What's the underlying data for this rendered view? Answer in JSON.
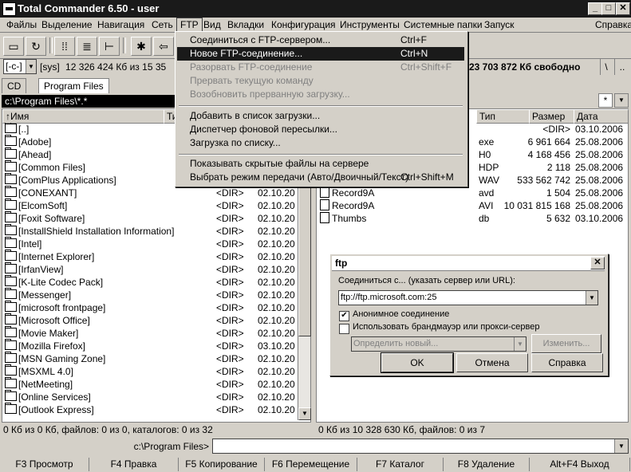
{
  "window": {
    "title": "Total Commander 6.50 - user"
  },
  "menubar": {
    "items": [
      "Файлы",
      "Выделение",
      "Навигация",
      "Сеть",
      "FTP",
      "Вид",
      "Вкладки",
      "Конфигурация",
      "Инструменты",
      "Системные папки",
      "Запуск"
    ],
    "help": "Справка"
  },
  "drivebar": {
    "left_drive": "[-c-]",
    "left_label": "[sys]",
    "left_free": "12 326 424 Кб из 15 35",
    "right_free": "23 703 872 Кб свободно",
    "root": "\\",
    "up": ".."
  },
  "tabs": {
    "cd": "CD",
    "program_files": "Program Files"
  },
  "left_panel": {
    "path": "c:\\Program Files\\*.*",
    "headers": {
      "name": "↑Имя",
      "type": "Ти"
    },
    "rows": [
      {
        "name": "[..]",
        "size": "",
        "date": ""
      },
      {
        "name": "[Adobe]",
        "size": "",
        "date": ""
      },
      {
        "name": "[Ahead]",
        "size": "",
        "date": ""
      },
      {
        "name": "[Common Files]",
        "size": "",
        "date": ""
      },
      {
        "name": "[ComPlus Applications]",
        "size": "",
        "date": ""
      },
      {
        "name": "[CONEXANT]",
        "size": "<DIR>",
        "date": "02.10.20"
      },
      {
        "name": "[ElcomSoft]",
        "size": "<DIR>",
        "date": "02.10.20"
      },
      {
        "name": "[Foxit Software]",
        "size": "<DIR>",
        "date": "02.10.20"
      },
      {
        "name": "[InstallShield Installation Information]",
        "size": "<DIR>",
        "date": "02.10.20"
      },
      {
        "name": "[Intel]",
        "size": "<DIR>",
        "date": "02.10.20"
      },
      {
        "name": "[Internet Explorer]",
        "size": "<DIR>",
        "date": "02.10.20"
      },
      {
        "name": "[IrfanView]",
        "size": "<DIR>",
        "date": "02.10.20"
      },
      {
        "name": "[K-Lite Codec Pack]",
        "size": "<DIR>",
        "date": "02.10.20"
      },
      {
        "name": "[Messenger]",
        "size": "<DIR>",
        "date": "02.10.20"
      },
      {
        "name": "[microsoft frontpage]",
        "size": "<DIR>",
        "date": "02.10.20"
      },
      {
        "name": "[Microsoft Office]",
        "size": "<DIR>",
        "date": "02.10.20"
      },
      {
        "name": "[Movie Maker]",
        "size": "<DIR>",
        "date": "02.10.20"
      },
      {
        "name": "[Mozilla Firefox]",
        "size": "<DIR>",
        "date": "03.10.20"
      },
      {
        "name": "[MSN Gaming Zone]",
        "size": "<DIR>",
        "date": "02.10.20"
      },
      {
        "name": "[MSXML 4.0]",
        "size": "<DIR>",
        "date": "02.10.20"
      },
      {
        "name": "[NetMeeting]",
        "size": "<DIR>",
        "date": "02.10.20"
      },
      {
        "name": "[Online Services]",
        "size": "<DIR>",
        "date": "02.10.20"
      },
      {
        "name": "[Outlook Express]",
        "size": "<DIR>",
        "date": "02.10.20"
      }
    ],
    "status": "0 Кб из 0 Кб, файлов: 0 из 0, каталогов: 0 из 32"
  },
  "right_panel": {
    "star": "*",
    "headers": {
      "type": "Тип",
      "size": "Размер",
      "date": "Дата"
    },
    "rows": [
      {
        "name": "",
        "type": "",
        "size": "<DIR>",
        "date": "03.10.2006"
      },
      {
        "name": "",
        "type": "exe",
        "size": "6 961 664",
        "date": "25.08.2006"
      },
      {
        "name": "",
        "type": "H0",
        "size": "4 168 456",
        "date": "25.08.2006"
      },
      {
        "name": "",
        "type": "HDP",
        "size": "2 118",
        "date": "25.08.2006"
      },
      {
        "name": "",
        "type": "WAV",
        "size": "533 562 742",
        "date": "25.08.2006"
      },
      {
        "name": "Record9A",
        "type": "avd",
        "size": "1 504",
        "date": "25.08.2006"
      },
      {
        "name": "Record9A",
        "type": "AVI",
        "size": "10 031 815 168",
        "date": "25.08.2006"
      },
      {
        "name": "Thumbs",
        "type": "db",
        "size": "5 632",
        "date": "03.10.2006"
      }
    ],
    "status": "0 Кб из 10 328 630 Кб, файлов: 0 из 7"
  },
  "cmdline": {
    "path": "c:\\Program Files>",
    "value": ""
  },
  "fkeys": [
    "F3 Просмотр",
    "F4 Правка",
    "F5 Копирование",
    "F6 Перемещение",
    "F7 Каталог",
    "F8 Удаление",
    "Alt+F4 Выход"
  ],
  "ftp_menu": {
    "items": [
      {
        "label": "Соединиться с FTP-сервером...",
        "shortcut": "Ctrl+F"
      },
      {
        "label": "Новое FTP-соединение...",
        "shortcut": "Ctrl+N"
      },
      {
        "label": "Разорвать FTP-соединение",
        "shortcut": "Ctrl+Shift+F"
      },
      {
        "label": "Прервать текущую команду",
        "shortcut": ""
      },
      {
        "label": "Возобновить прерванную загрузку...",
        "shortcut": ""
      },
      {
        "label": "Добавить в список загрузки...",
        "shortcut": ""
      },
      {
        "label": "Диспетчер фоновой пересылки...",
        "shortcut": ""
      },
      {
        "label": "Загрузка по списку...",
        "shortcut": ""
      },
      {
        "label": "Показывать скрытые файлы на сервере",
        "shortcut": ""
      },
      {
        "label": "Выбрать режим передачи (Авто/Двоичный/Текст)",
        "shortcut": "Ctrl+Shift+M"
      }
    ]
  },
  "ftp_dialog": {
    "title": "ftp",
    "prompt": "Соединиться с... (указать сервер или URL):",
    "url": "ftp://ftp.microsoft.com:25",
    "anon_label": "Анонимное соединение",
    "anon_checked": true,
    "proxy_label": "Использовать брандмауэр или прокси-сервер",
    "proxy_checked": false,
    "proxy_select": "Определить новый...",
    "change_label": "Изменить...",
    "ok": "OK",
    "cancel": "Отмена",
    "help": "Справка"
  }
}
